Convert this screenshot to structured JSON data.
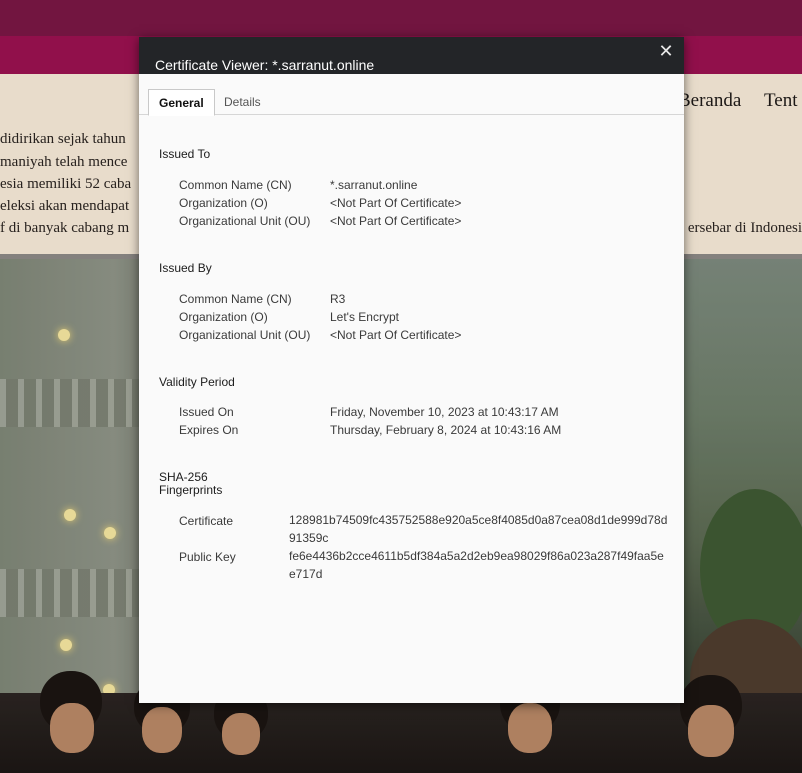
{
  "site": {
    "nav": [
      "Beranda",
      "Tent"
    ],
    "lines": [
      "didirikan sejak tahun",
      "maniyah telah mence",
      "esia memiliki 52 caba",
      "eleksi akan mendapat",
      "f di banyak cabang m"
    ],
    "line_right": "ersebar di Indonesi"
  },
  "dialog": {
    "title": "Certificate Viewer: *.sarranut.online",
    "close_glyph": "✕",
    "tabs": [
      {
        "label": "General",
        "active": true
      },
      {
        "label": "Details",
        "active": false
      }
    ],
    "issued_to": {
      "title": "Issued To",
      "rows": [
        {
          "label": "Common Name (CN)",
          "value": "*.sarranut.online"
        },
        {
          "label": "Organization (O)",
          "value": "<Not Part Of Certificate>"
        },
        {
          "label": "Organizational Unit (OU)",
          "value": "<Not Part Of Certificate>"
        }
      ]
    },
    "issued_by": {
      "title": "Issued By",
      "rows": [
        {
          "label": "Common Name (CN)",
          "value": "R3"
        },
        {
          "label": "Organization (O)",
          "value": "Let's Encrypt"
        },
        {
          "label": "Organizational Unit (OU)",
          "value": "<Not Part Of Certificate>"
        }
      ]
    },
    "validity": {
      "title": "Validity Period",
      "rows": [
        {
          "label": "Issued On",
          "value": "Friday, November 10, 2023 at 10:43:17 AM"
        },
        {
          "label": "Expires On",
          "value": "Thursday, February 8, 2024 at 10:43:16 AM"
        }
      ]
    },
    "fingerprints": {
      "title_line1": "SHA-256",
      "title_line2": "Fingerprints",
      "rows": [
        {
          "label": "Certificate",
          "value": "128981b74509fc435752588e920a5ce8f4085d0a87cea08d1de999d78d91359c"
        },
        {
          "label": "Public Key",
          "value": "fe6e4436b2cce4611b5df384a5a2d2eb9ea98029f86a023a287f49faa5ee717d"
        }
      ]
    }
  }
}
